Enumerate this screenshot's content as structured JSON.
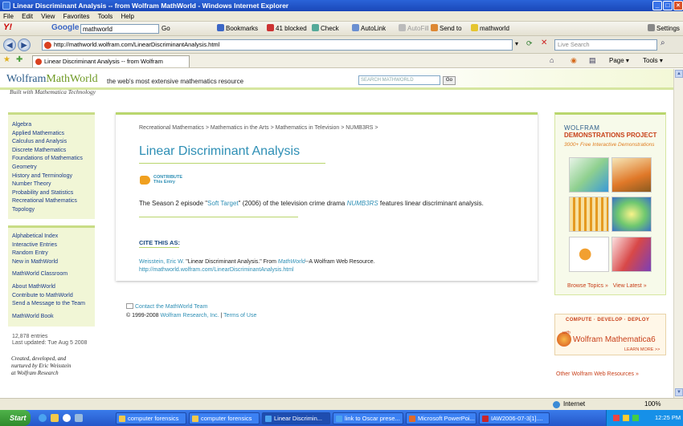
{
  "window": {
    "title": "Linear Discriminant Analysis -- from Wolfram MathWorld - Windows Internet Explorer"
  },
  "menu": [
    "File",
    "Edit",
    "View",
    "Favorites",
    "Tools",
    "Help"
  ],
  "yahoo_toolbar": {
    "brand": "Y!",
    "google_label": "Google",
    "search_value": "mathworld",
    "go_label": "Go",
    "bookmarks": "Bookmarks",
    "blocked": "41 blocked",
    "check": "Check",
    "autolink": "AutoLink",
    "autofill": "AutoFill",
    "sendto": "Send to",
    "term": "mathworld",
    "settings": "Settings"
  },
  "address_bar": {
    "url": "http://mathworld.wolfram.com/LinearDiscriminantAnalysis.html",
    "live_search_placeholder": "Live Search"
  },
  "tab": {
    "label": "Linear Discriminant Analysis -- from Wolfram MathWorld"
  },
  "command_bar": {
    "page": "Page",
    "tools": "Tools"
  },
  "mathworld": {
    "logo_wolfram": "Wolfram",
    "logo_mathworld": "MathWorld",
    "tagline": "the web's most extensive mathematics resource",
    "search_placeholder": "SEARCH MATHWORLD",
    "go": "Go",
    "built_with": "Built with Mathematica Technology"
  },
  "sidebar": {
    "topics": [
      "Algebra",
      "Applied Mathematics",
      "Calculus and Analysis",
      "Discrete Mathematics",
      "Foundations of Mathematics",
      "Geometry",
      "History and Terminology",
      "Number Theory",
      "Probability and Statistics",
      "Recreational Mathematics",
      "Topology"
    ],
    "links": [
      "Alphabetical Index",
      "Interactive Entries",
      "Random Entry",
      "New in MathWorld"
    ],
    "classroom": "MathWorld Classroom",
    "about_links": [
      "About MathWorld",
      "Contribute to MathWorld",
      "Send a Message to the Team"
    ],
    "book": "MathWorld Book",
    "entries": "12,878 entries",
    "last_updated": "Last updated: Tue Aug 5 2008",
    "credit_1": "Created, developed, and",
    "credit_2": "nurtured by Eric Weisstein",
    "credit_3": "at Wolfram Research"
  },
  "content": {
    "breadcrumb": "Recreational Mathematics > Mathematics in the Arts > Mathematics in Television > NUMB3RS >",
    "title": "Linear Discriminant Analysis",
    "contribute_1": "CONTRIBUTE",
    "contribute_2": "This Entry",
    "desc_pre": "The Season 2 episode \"",
    "desc_link": "Soft Target",
    "desc_mid": "\" (2006) of the television crime drama ",
    "desc_show": "NUMB3RS",
    "desc_post": " features linear discriminant analysis.",
    "cite_heading": "CITE THIS AS:",
    "cite_author": "Weisstein, Eric W.",
    "cite_text": " \"Linear Discriminant Analysis.\" From ",
    "cite_source": "MathWorld",
    "cite_tail": "--A Wolfram Web Resource.",
    "cite_url": "http://mathworld.wolfram.com/LinearDiscriminantAnalysis.html"
  },
  "footer": {
    "contact": "Contact the MathWorld Team",
    "copyright_pre": "© 1999-2008 ",
    "wolfram": "Wolfram Research, Inc.",
    "separator": " | ",
    "terms": "Terms of Use"
  },
  "demos": {
    "line1": "WOLFRAM",
    "line2": "DEMONSTRATIONS PROJECT",
    "line3": "3000+ Free Interactive Demonstrations",
    "browse": "Browse Topics »",
    "latest": "View Latest »"
  },
  "math_ad": {
    "compute": "COMPUTE · DEVELOP · DEPLOY",
    "with": "with",
    "product": "Wolfram Mathematica6",
    "learn": "LEARN MORE >>"
  },
  "other_resources": "Other Wolfram Web Resources »",
  "statusbar": {
    "zone": "Internet",
    "zoom": "100%"
  },
  "taskbar": {
    "start": "Start",
    "tasks": [
      "computer forensics",
      "computer forensics",
      "Linear Discrimin...",
      "link to Oscar prese...",
      "Microsoft PowerPoi...",
      "IAW2006-07-3[1]...."
    ],
    "clock": "12:25 PM"
  }
}
